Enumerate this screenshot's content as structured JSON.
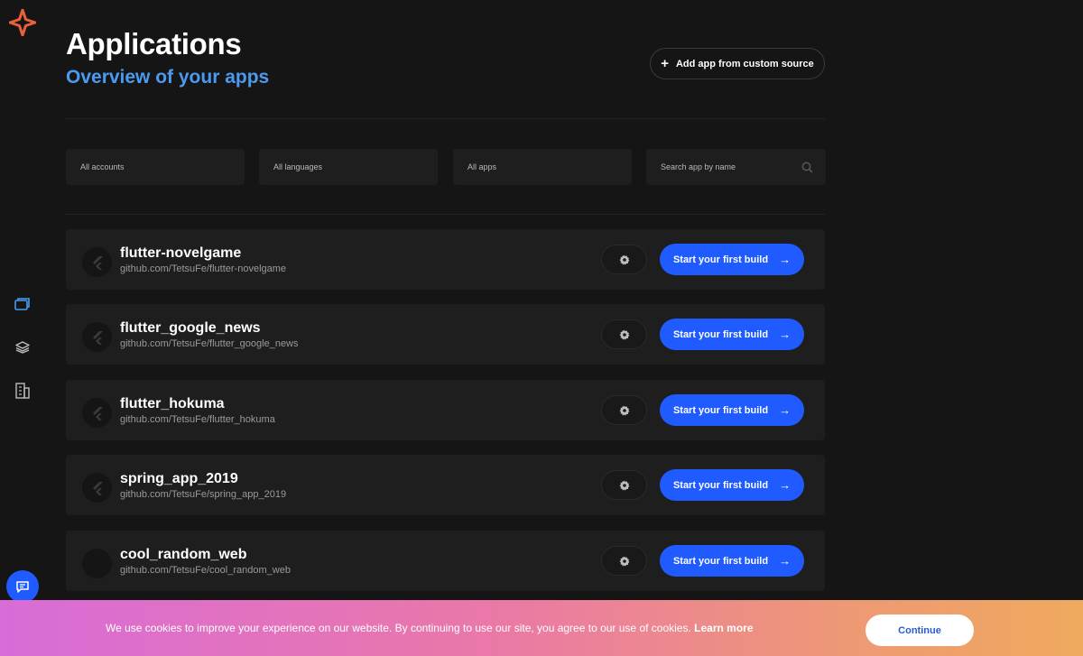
{
  "header": {
    "title": "Applications",
    "subtitle": "Overview of your apps",
    "add_button_label": "Add app from custom source"
  },
  "filters": {
    "accounts": "All accounts",
    "languages": "All languages",
    "apps": "All apps",
    "search_placeholder": "Search app by name"
  },
  "apps": [
    {
      "name": "flutter-novelgame",
      "repo": "github.com/TetsuFe/flutter-novelgame",
      "build_label": "Start your first build",
      "icon": "flutter-icon"
    },
    {
      "name": "flutter_google_news",
      "repo": "github.com/TetsuFe/flutter_google_news",
      "build_label": "Start your first build",
      "icon": "flutter-icon"
    },
    {
      "name": "flutter_hokuma",
      "repo": "github.com/TetsuFe/flutter_hokuma",
      "build_label": "Start your first build",
      "icon": "flutter-icon"
    },
    {
      "name": "spring_app_2019",
      "repo": "github.com/TetsuFe/spring_app_2019",
      "build_label": "Start your first build",
      "icon": "flutter-icon"
    },
    {
      "name": "cool_random_web",
      "repo": "github.com/TetsuFe/cool_random_web",
      "build_label": "Start your first build",
      "icon": ""
    }
  ],
  "cookie": {
    "text": "We use cookies to improve your experience on our website. By continuing to use our site, you agree to our use of cookies.",
    "learn_more": "Learn more",
    "continue_label": "Continue"
  },
  "colors": {
    "accent": "#1f5bff",
    "subtitle": "#4a9bf0",
    "background": "#151515",
    "card": "#1e1e1e"
  }
}
